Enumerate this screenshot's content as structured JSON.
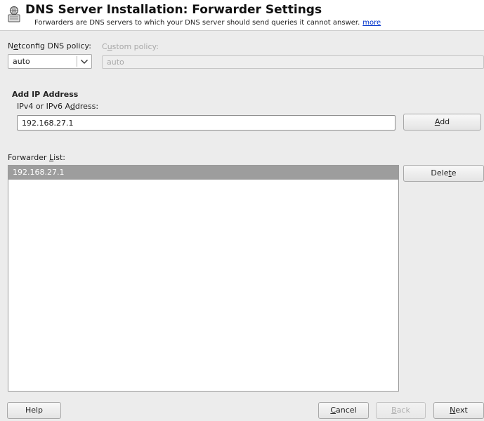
{
  "header": {
    "title": "DNS Server Installation: Forwarder Settings",
    "subtitle": "Forwarders are DNS servers to which your DNS server should send queries it cannot answer.",
    "more_link": "more",
    "icon": "dns-server-icon"
  },
  "netconfig": {
    "label_pre": "N",
    "label_u": "e",
    "label_post": "tconfig DNS policy:",
    "value": "auto",
    "arrow_icon": "chevron-down-icon"
  },
  "custom_policy": {
    "label_pre": "C",
    "label_u": "u",
    "label_post": "stom policy:",
    "value": "auto"
  },
  "add_ip": {
    "section_title": "Add IP Address",
    "field_label_pre": "IPv4 or IPv6 A",
    "field_label_u": "d",
    "field_label_post": "dress:",
    "value": "192.168.27.1",
    "button_u": "A",
    "button_post": "dd"
  },
  "forwarder_list": {
    "label_pre": "Forwarder ",
    "label_u": "L",
    "label_post": "ist:",
    "items": [
      "192.168.27.1"
    ],
    "delete_pre": "Dele",
    "delete_u": "t",
    "delete_post": "e"
  },
  "footer": {
    "help": "Help",
    "cancel_u": "C",
    "cancel_post": "ancel",
    "back_u": "B",
    "back_post": "ack",
    "next_u": "N",
    "next_post": "ext"
  }
}
